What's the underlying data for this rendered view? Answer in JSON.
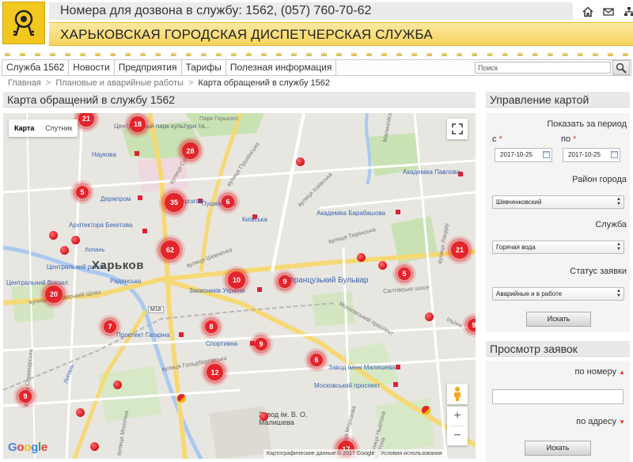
{
  "header": {
    "hotline": "Номера для дозвона в службу: 1562, (057) 760-70-62",
    "title": "ХАРЬКОВСКАЯ ГОРОДСКАЯ ДИСПЕТЧЕРСКАЯ СЛУЖБА",
    "icons": [
      "home-icon",
      "mail-icon",
      "sitemap-icon"
    ]
  },
  "nav": {
    "items": [
      "Служба 1562",
      "Новости",
      "Предприятия",
      "Тарифы",
      "Полезная информация"
    ],
    "search_placeholder": "Поиск"
  },
  "breadcrumb": [
    "Главная",
    "Плановые и аварийные работы",
    "Карта обращений в службу 1562"
  ],
  "map_section": {
    "title": "Карта обращений в службу 1562",
    "map_type": [
      "Карта",
      "Спутник"
    ],
    "city": "Харьков",
    "labels": [
      "Центральный парк культури та...",
      "Наукова",
      "Держпром",
      "Університет",
      "Пушкінська",
      "Архітектора Бекетова",
      "Київська",
      "Академіка Павлова",
      "Академіка Барабашова",
      "Центральний ринок",
      "Радянська",
      "Захисників України",
      "Французький Бульвар",
      "Центральний Вокзал",
      "Проспект Гагаріна",
      "Спортивна",
      "Завод імені Малишева",
      "Московський проспект",
      "Завод ім. В. О. Малишева",
      "Парк Горького",
      "вулиця Сумська",
      "вулиця Пушкінська",
      "вулиця Шевченка",
      "вулиця Ісаївська",
      "Лопань",
      "вулиця Полтавський Шлях",
      "M18",
      "Салтівське шосе",
      "вулиця Гольдбергівська",
      "Московський проспект",
      "вулиця Молочна",
      "вулиця Морозова",
      "вулиця Ньютона",
      "Малиновського",
      "вулиця Семинарська",
      "вулиця Ландау",
      "вулиця Тюрінська",
      "Лопань",
      "Ільїна",
      "Ньютона"
    ],
    "clusters": [
      "21",
      "18",
      "28",
      "5",
      "35",
      "6",
      "62",
      "10",
      "9",
      "21",
      "5",
      "20",
      "7",
      "8",
      "9",
      "6",
      "12",
      "9",
      "17",
      "9"
    ],
    "attribution": "Картографические данные © 2017 Google",
    "terms": "Условия использования",
    "google": "Google"
  },
  "panel": {
    "title": "Управление картой",
    "period_label": "Показать за период",
    "from_label": "с",
    "to_label": "по",
    "required_mark": "*",
    "from_date": "2017-10-25",
    "to_date": "2017-10-25",
    "district_label": "Район города",
    "district_value": "Шевченковский",
    "service_label": "Служба",
    "service_value": "Горячая вода",
    "status_label": "Статус заявки",
    "status_value": "Аварийные и в работе",
    "search_button": "Искать"
  },
  "requests": {
    "title": "Просмотр заявок",
    "by_number": "по номеру",
    "by_address": "по адресу",
    "search_button": "Искать"
  },
  "colors": {
    "accent_yellow": "#f7d35c",
    "cluster_red": "#e3242b",
    "header_gray": "#e9e9e9"
  }
}
